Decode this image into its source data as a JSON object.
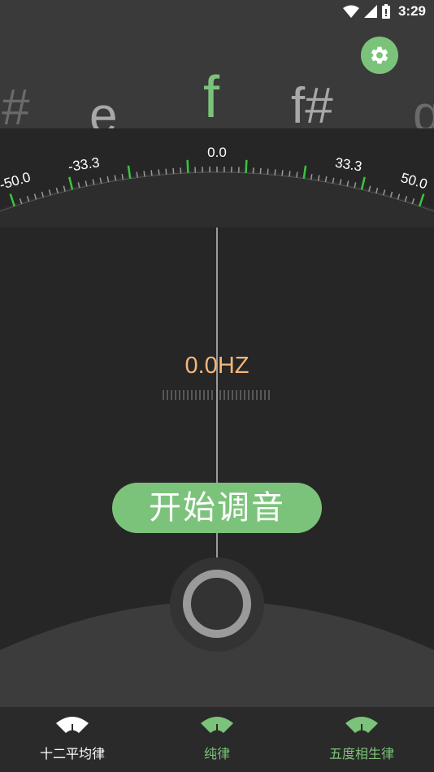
{
  "status_bar": {
    "time": "3:29",
    "icons": [
      "wifi-icon",
      "signal-icon",
      "battery-icon"
    ]
  },
  "settings": {
    "icon": "gear-icon",
    "color": "#7bc37a"
  },
  "notes": {
    "items": [
      "#",
      "e",
      "f",
      "f#",
      "g"
    ],
    "current": "f",
    "current_color": "#7bc37a"
  },
  "scale": {
    "labels": [
      "-50.0",
      "-33.3",
      "0.0",
      "33.3",
      "50.0"
    ],
    "range": [
      -50,
      50
    ]
  },
  "frequency": {
    "display": "0.0HZ",
    "color": "#f4b57a"
  },
  "start_button": {
    "label": "开始调音",
    "color": "#7bc37a"
  },
  "bottom_nav": {
    "items": [
      {
        "label": "十二平均律",
        "icon": "gauge-icon",
        "active": true
      },
      {
        "label": "纯律",
        "icon": "gauge-icon",
        "active": false
      },
      {
        "label": "五度相生律",
        "icon": "gauge-icon",
        "active": false
      }
    ],
    "active_color": "#ffffff",
    "inactive_color": "#7bc37a"
  }
}
